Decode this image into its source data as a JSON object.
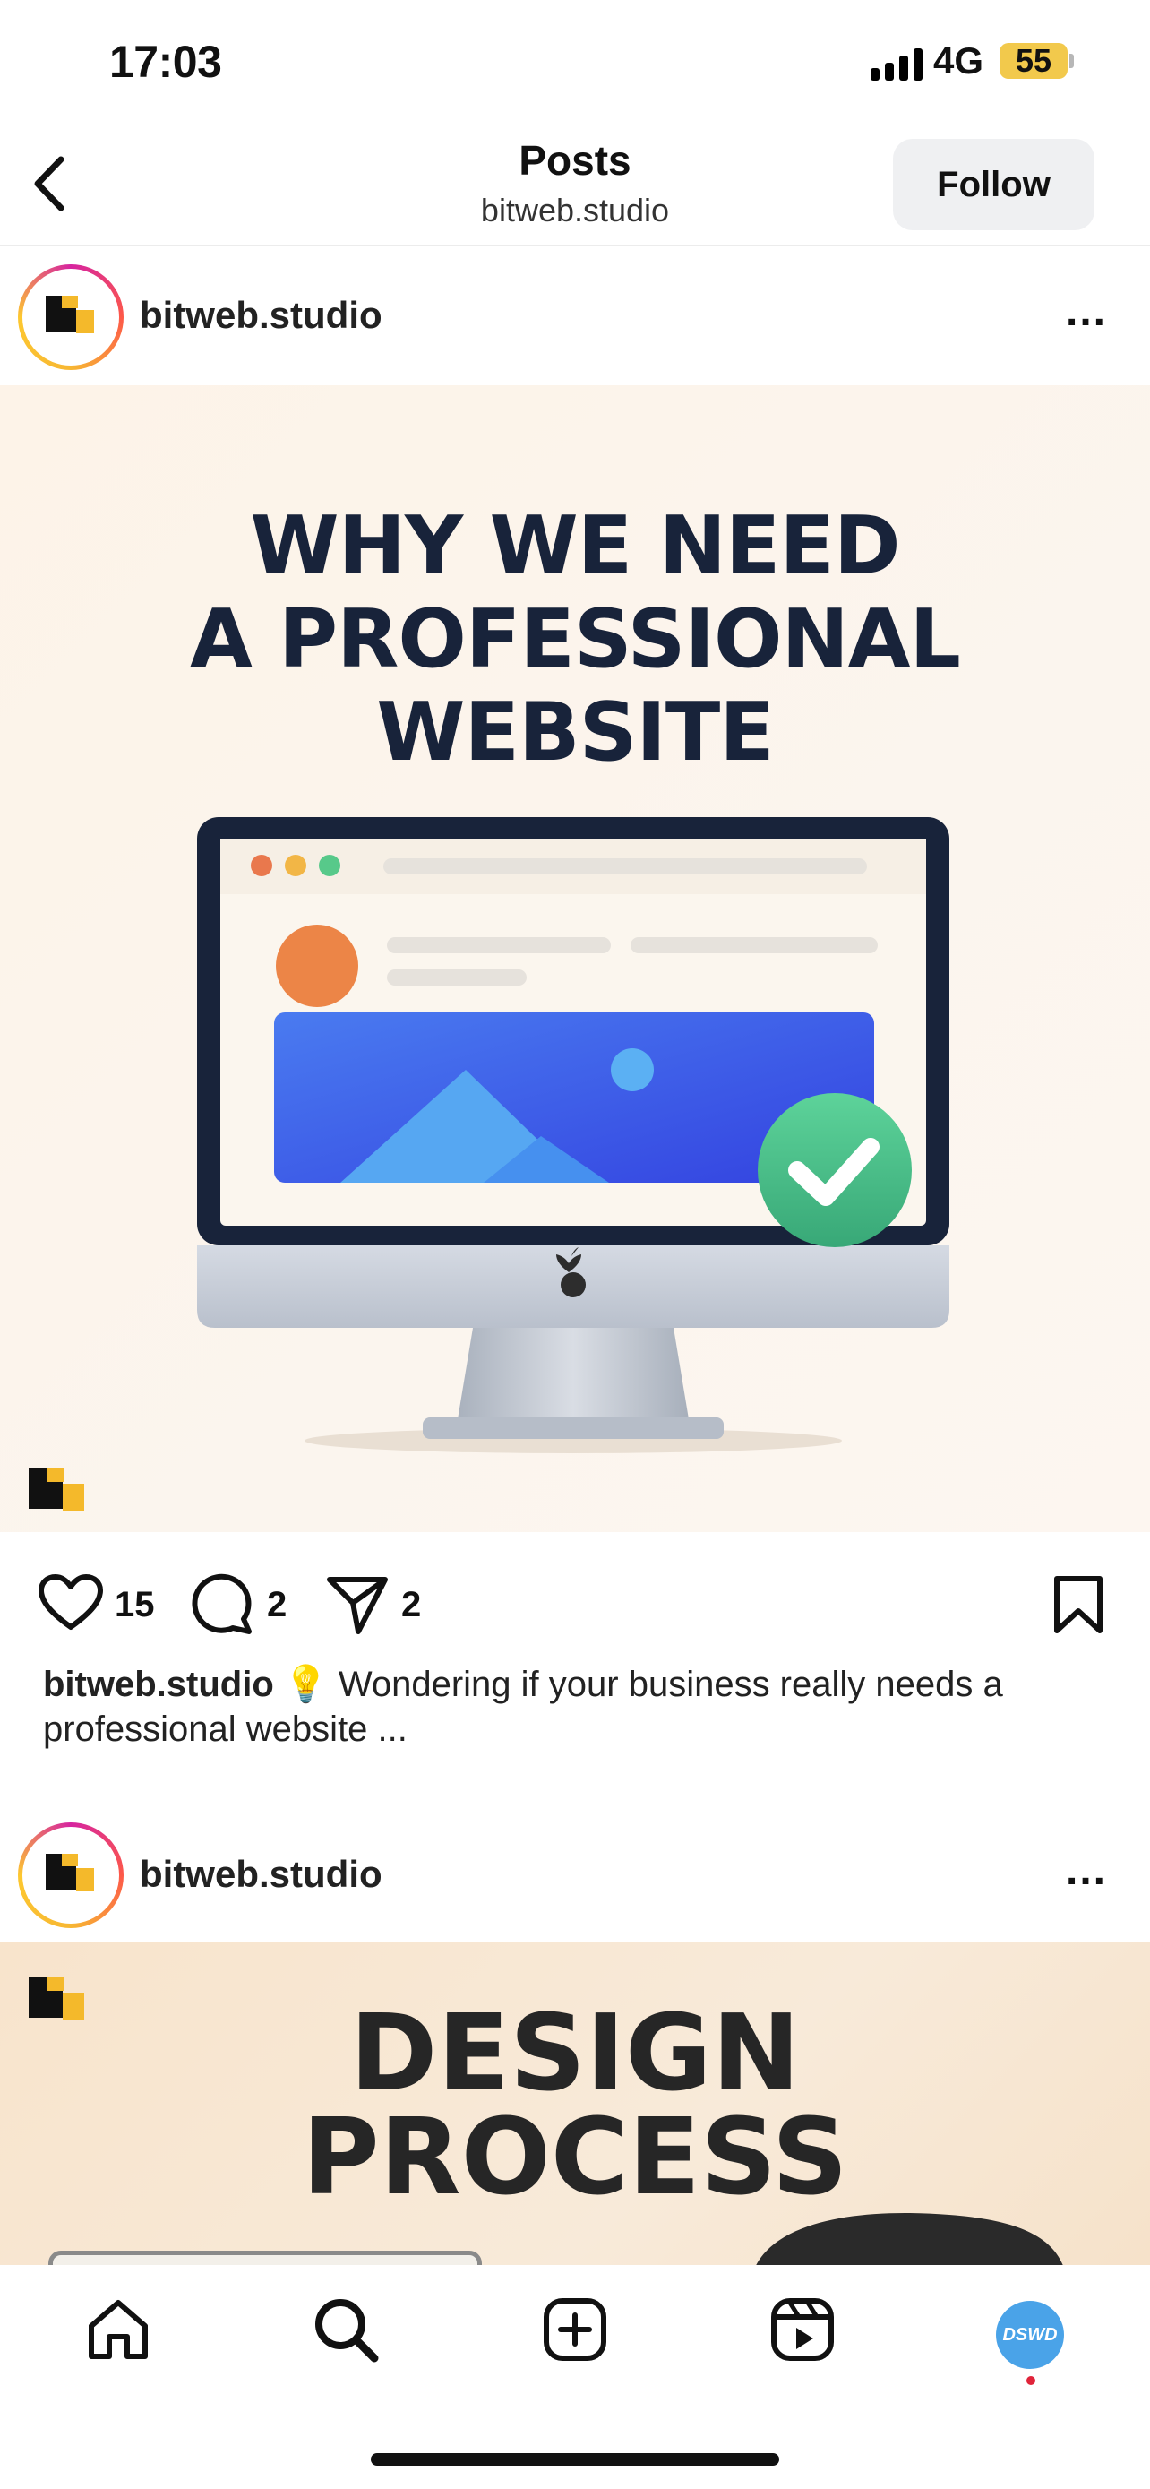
{
  "status_bar": {
    "time": "17:03",
    "network": "4G",
    "battery": "55"
  },
  "header": {
    "title": "Posts",
    "subtitle": "bitweb.studio",
    "follow_label": "Follow"
  },
  "posts": [
    {
      "username": "bitweb.studio",
      "more": "...",
      "image_headline": [
        "WHY WE NEED",
        "A PROFESSIONAL",
        "WEBSITE"
      ],
      "likes": "15",
      "comments": "2",
      "shares": "2",
      "caption_user": "bitweb.studio",
      "caption_emoji": "💡",
      "caption_text": "Wondering if your business really needs a professional website ..."
    },
    {
      "username": "bitweb.studio",
      "more": "...",
      "image_headline": [
        "DESIGN",
        "PROCESS"
      ]
    }
  ],
  "tabbar": {
    "items": [
      "home-icon",
      "search-icon",
      "create-icon",
      "reels-icon",
      "profile"
    ],
    "profile_initials": "DSWD"
  },
  "colors": {
    "follow_bg": "#eff0f2",
    "headline": "#18233a",
    "check": "#4fc189",
    "screen_blue": "#3a5ce6"
  }
}
